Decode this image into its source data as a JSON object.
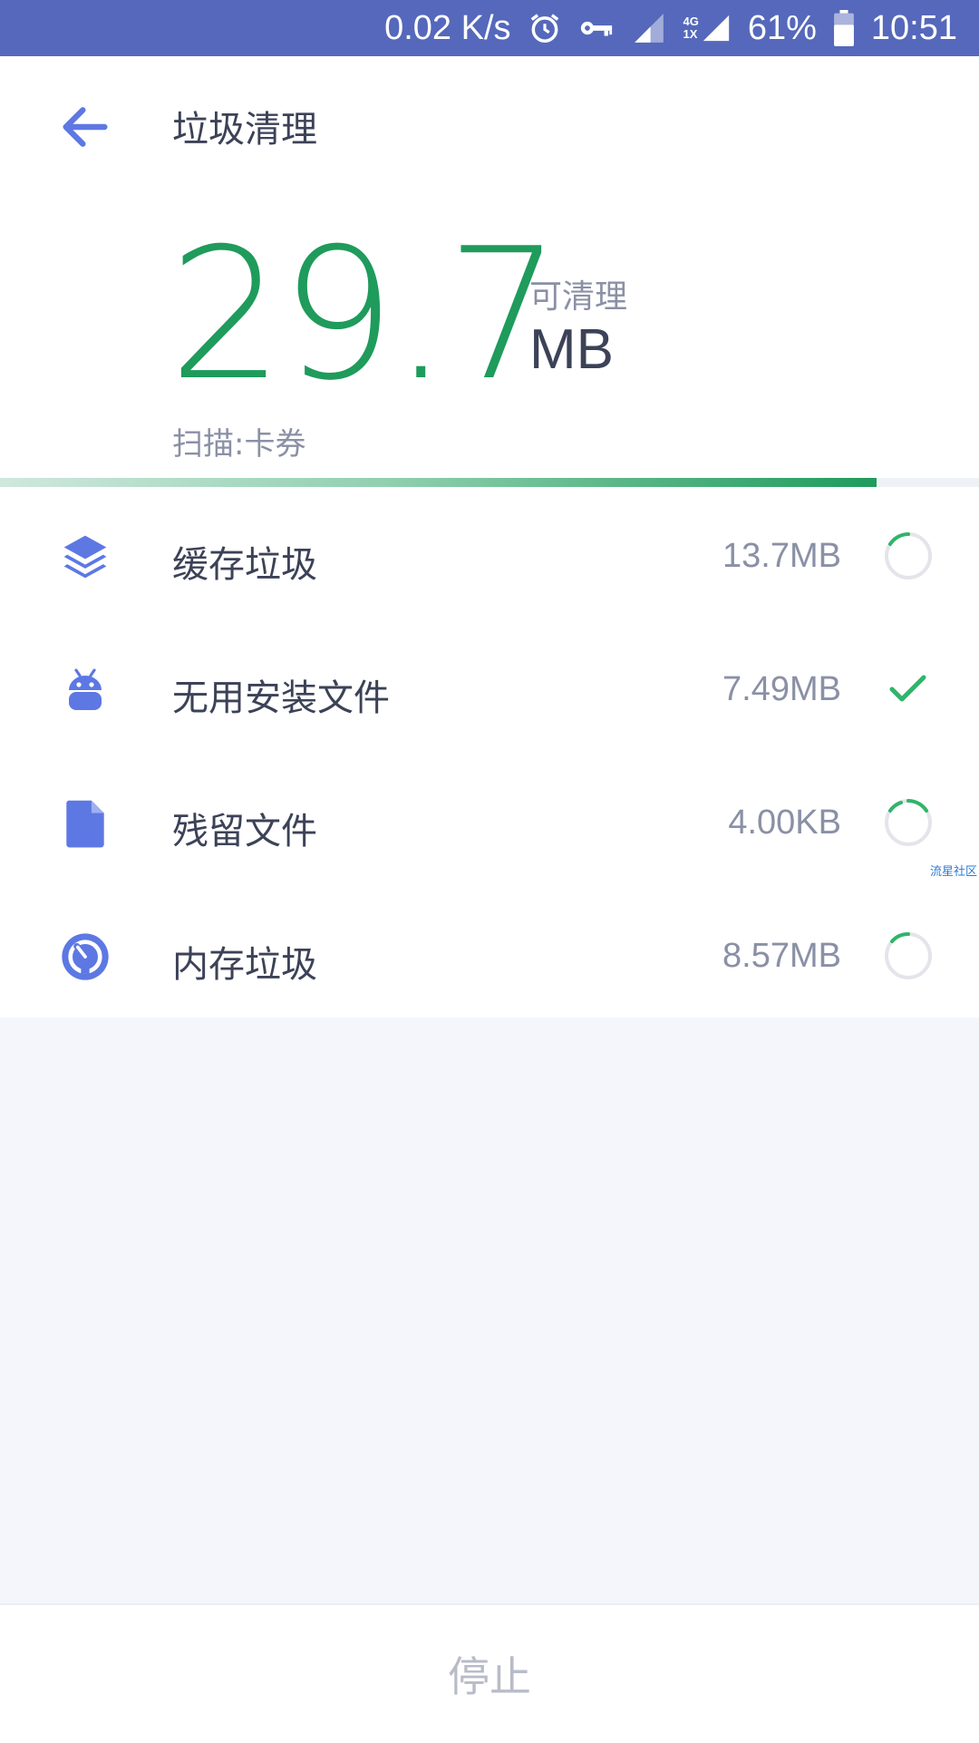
{
  "status_bar": {
    "net_speed": "0.02 K/s",
    "network_type_top": "4G",
    "network_type_bottom": "1X",
    "battery": "61%",
    "time": "10:51",
    "bg_color": "#5568bb"
  },
  "header": {
    "title": "垃圾清理",
    "back_icon": "arrow-left-icon"
  },
  "summary": {
    "amount": "29.7",
    "amount_label": "可清理",
    "unit": "MB",
    "scan_status": "扫描:卡券",
    "progress_fraction": 0.895,
    "accent_color": "#1f9b5c"
  },
  "items": [
    {
      "icon": "layers-icon",
      "label": "缓存垃圾",
      "size": "13.7MB",
      "status": "scanning"
    },
    {
      "icon": "android-icon",
      "label": "无用安装文件",
      "size": "7.49MB",
      "status": "done"
    },
    {
      "icon": "file-icon",
      "label": "残留文件",
      "size": "4.00KB",
      "status": "scanning"
    },
    {
      "icon": "speedometer-icon",
      "label": "内存垃圾",
      "size": "8.57MB",
      "status": "scanning"
    }
  ],
  "watermark": "流星社区",
  "footer": {
    "stop_label": "停止"
  },
  "icon_color": "#5d78e3"
}
